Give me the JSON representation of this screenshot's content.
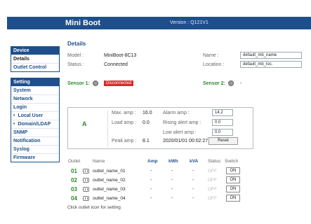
{
  "header": {
    "brand_mini": "Mini",
    "brand_boot": "Boot",
    "version": "Version : Q121V1"
  },
  "sidebar": {
    "device_group": {
      "heading": "Device",
      "items": [
        "Details",
        "Outlet Control"
      ]
    },
    "setting_group": {
      "heading": "Setting",
      "items": [
        "System",
        "Network",
        "Login",
        "Local User",
        "Domain/LDAP",
        "SNMP",
        "Notification",
        "Syslog",
        "Firmware"
      ]
    }
  },
  "details": {
    "title": "Details",
    "model_label": "Model :",
    "model_value": "MiniBoot-8C13",
    "status_label": "Status :",
    "status_value": "Connected",
    "name_label": "Name :",
    "name_value": "default_mb_name",
    "location_label": "Location :",
    "location_value": "default_mb_loc."
  },
  "sensors": {
    "sensor1_label": "Sensor 1:",
    "sensor1_status": "Disconnected",
    "sensor2_label": "Sensor 2:",
    "sensor2_status": "-"
  },
  "panel": {
    "letter": "A",
    "max_amp_label": "Max. amp :",
    "max_amp_value": "16.0",
    "load_amp_label": "Load amp :",
    "load_amp_value": "0.0",
    "peak_amp_label": "Peak amp :",
    "peak_amp_value": "8.1",
    "alarm_amp_label": "Alarm amp :",
    "alarm_amp_value": "14.2",
    "rising_label": "Rising alert amp :",
    "rising_value": "0.0",
    "low_label": "Low alert amp :",
    "low_value": "0.0",
    "peak_time": "2020/01/01 00:02:27",
    "reset_label": "Reset"
  },
  "table": {
    "headers": {
      "outlet": "Outlet",
      "name": "Name",
      "amp": "Amp",
      "kwh": "kWh",
      "kva": "kVA",
      "status": "Status",
      "switch": "Switch"
    },
    "rows": [
      {
        "num": "01",
        "name": "outlet_name_01",
        "amp": "-",
        "kwh": "-",
        "kva": "-",
        "status": "OFF",
        "switch": "ON"
      },
      {
        "num": "02",
        "name": "outlet_name_02",
        "amp": "-",
        "kwh": "-",
        "kva": "-",
        "status": "OFF",
        "switch": "ON"
      },
      {
        "num": "03",
        "name": "outlet_name_03",
        "amp": "-",
        "kwh": "-",
        "kva": "-",
        "status": "OFF",
        "switch": "ON"
      },
      {
        "num": "04",
        "name": "outlet_name_04",
        "amp": "-",
        "kwh": "-",
        "kva": "-",
        "status": "OFF",
        "switch": "ON"
      }
    ],
    "hint": "Click outlet icon for setting"
  },
  "colors": {
    "brand_blue": "#1e4f8c",
    "accent_green": "#2a8a2a",
    "alert_red": "#d62a2a"
  }
}
